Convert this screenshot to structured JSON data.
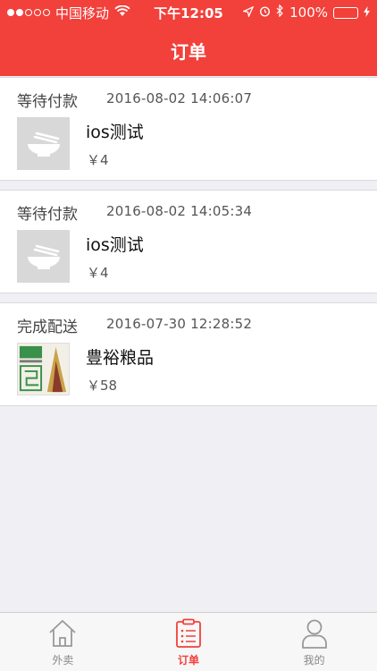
{
  "status_bar": {
    "carrier": "中国移动",
    "time": "下午12:05",
    "battery": "100%",
    "signal_bars_filled": 2,
    "signal_bars_total": 5
  },
  "header": {
    "title": "订单"
  },
  "orders": [
    {
      "status": "等待付款",
      "time": "2016-08-02 14:06:07",
      "name": "ios测试",
      "price": "￥4",
      "thumb_icon": "bowl-chopsticks-placeholder-icon"
    },
    {
      "status": "等待付款",
      "time": "2016-08-02 14:05:34",
      "name": "ios测试",
      "price": "￥4",
      "thumb_icon": "bowl-chopsticks-placeholder-icon"
    },
    {
      "status": "完成配送",
      "time": "2016-07-30 12:28:52",
      "name": "豊裕粮品",
      "price": "￥58",
      "thumb_icon": "store-logo-image"
    }
  ],
  "tabs": [
    {
      "label": "外卖",
      "icon": "home-icon",
      "active": false
    },
    {
      "label": "订单",
      "icon": "order-list-icon",
      "active": true
    },
    {
      "label": "我的",
      "icon": "person-icon",
      "active": false
    }
  ],
  "colors": {
    "accent": "#f2403a",
    "background": "#efeff4",
    "battery": "#4cd964"
  }
}
